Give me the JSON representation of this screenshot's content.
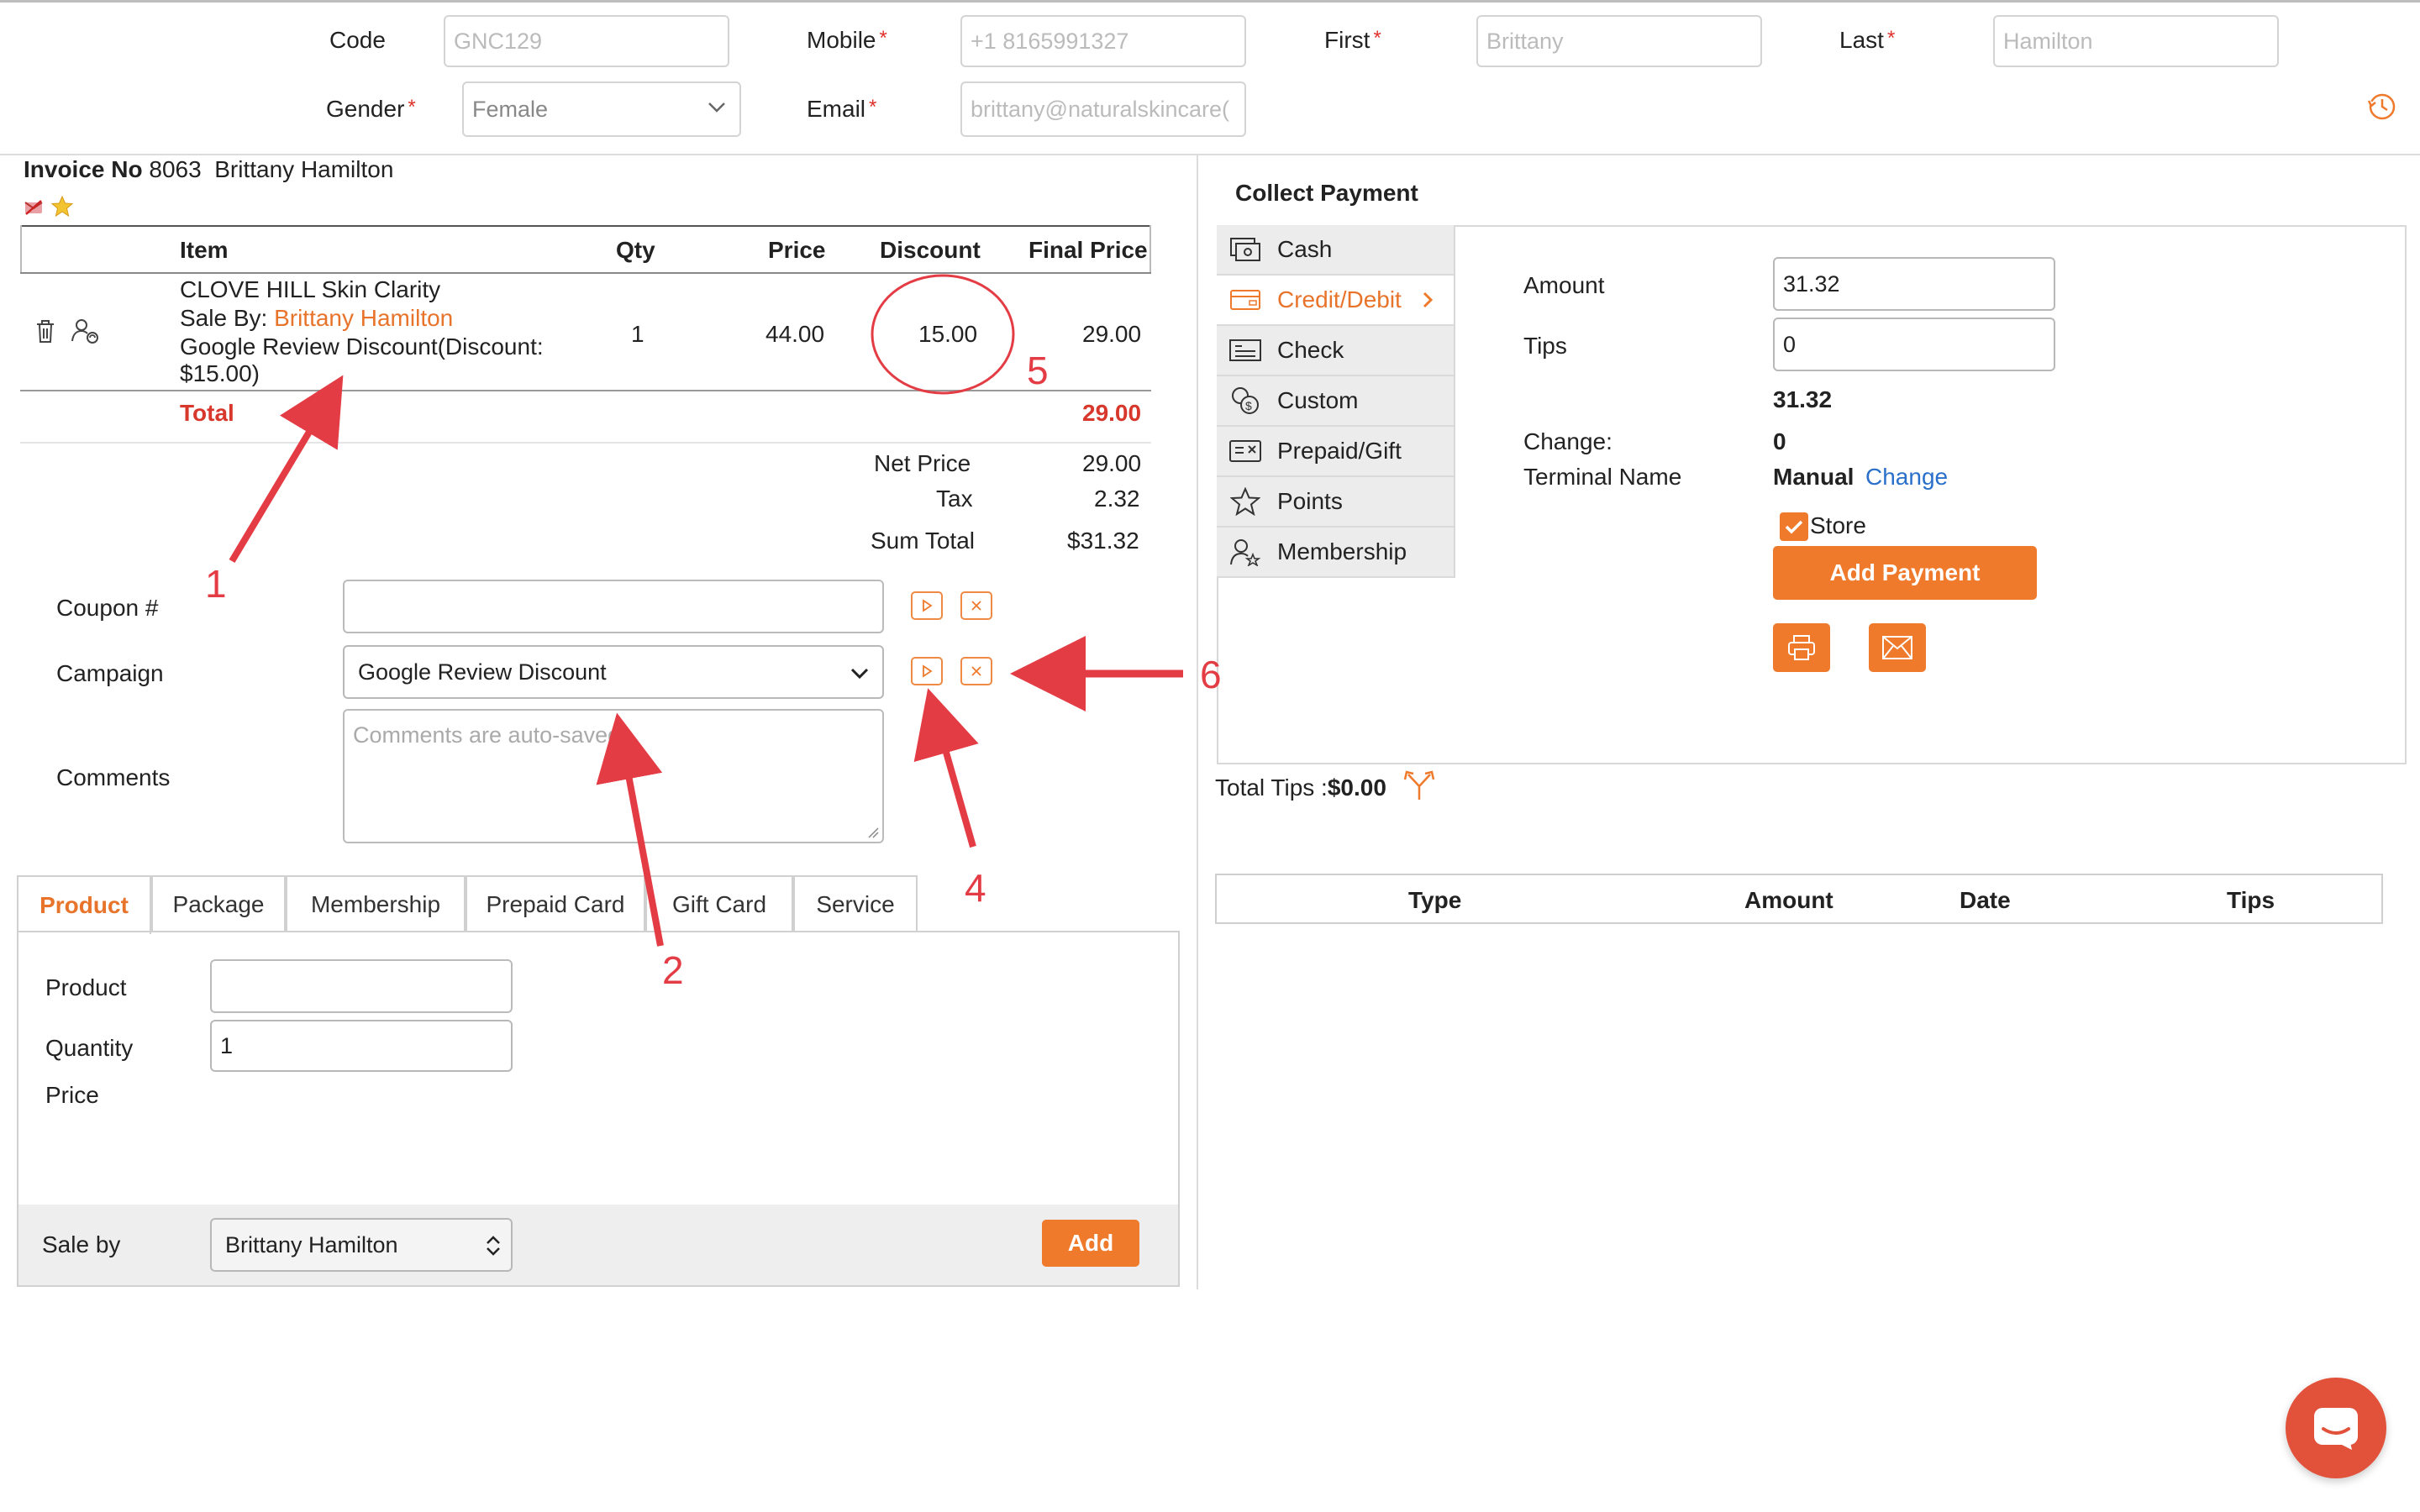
{
  "header": {
    "code": {
      "label": "Code",
      "placeholder": "GNC129"
    },
    "mobile": {
      "label": "Mobile",
      "placeholder": "+1 8165991327"
    },
    "first": {
      "label": "First",
      "placeholder": "Brittany"
    },
    "last": {
      "label": "Last",
      "placeholder": "Hamilton"
    },
    "gender": {
      "label": "Gender",
      "value": "Female"
    },
    "email": {
      "label": "Email",
      "placeholder": "brittany@naturalskincare("
    },
    "required_mark": "*"
  },
  "invoice": {
    "label": "Invoice No",
    "number": "8063",
    "customer": "Brittany Hamilton",
    "columns": [
      "Item",
      "Qty",
      "Price",
      "Discount",
      "Final Price"
    ],
    "item": {
      "name": "CLOVE HILL Skin Clarity",
      "sale_by_label": "Sale By:",
      "sale_by": "Brittany Hamilton",
      "discount_line1": "Google Review Discount(Discount:",
      "discount_line2": "$15.00)",
      "qty": "1",
      "price": "44.00",
      "discount": "15.00",
      "final": "29.00"
    },
    "total_label": "Total",
    "total_value": "29.00",
    "net_price_label": "Net Price",
    "net_price": "29.00",
    "tax_label": "Tax",
    "tax": "2.32",
    "sum_total_label": "Sum Total",
    "sum_total": "$31.32"
  },
  "form": {
    "coupon_label": "Coupon #",
    "campaign_label": "Campaign",
    "campaign_value": "Google Review Discount",
    "comments_label": "Comments",
    "comments_placeholder": "Comments are auto-saved"
  },
  "tabs": [
    "Product",
    "Package",
    "Membership",
    "Prepaid Card",
    "Gift Card",
    "Service"
  ],
  "product_form": {
    "product_label": "Product",
    "quantity_label": "Quantity",
    "quantity_value": "1",
    "price_label": "Price",
    "sale_by_label": "Sale by",
    "sale_by_value": "Brittany Hamilton",
    "add_label": "Add"
  },
  "payment": {
    "title": "Collect Payment",
    "methods": [
      "Cash",
      "Credit/Debit",
      "Check",
      "Custom",
      "Prepaid/Gift",
      "Points",
      "Membership"
    ],
    "active_method": "Credit/Debit",
    "amount_label": "Amount",
    "amount_value": "31.32",
    "tips_label": "Tips",
    "tips_value": "0",
    "total_display": "31.32",
    "change_label": "Change:",
    "change_value": "0",
    "terminal_label": "Terminal Name",
    "terminal_value": "Manual",
    "change_link": "Change",
    "store_label": "Store",
    "add_payment_label": "Add Payment",
    "total_tips_label": "Total Tips :",
    "total_tips_value": "$0.00",
    "table_columns": [
      "Type",
      "Amount",
      "Date",
      "Tips"
    ]
  },
  "annotations": [
    "1",
    "2",
    "4",
    "5",
    "6"
  ],
  "colors": {
    "accent": "#ef7a2c",
    "total_red": "#d8382b",
    "annotation": "#e43c44",
    "link": "#2a6fc9"
  }
}
